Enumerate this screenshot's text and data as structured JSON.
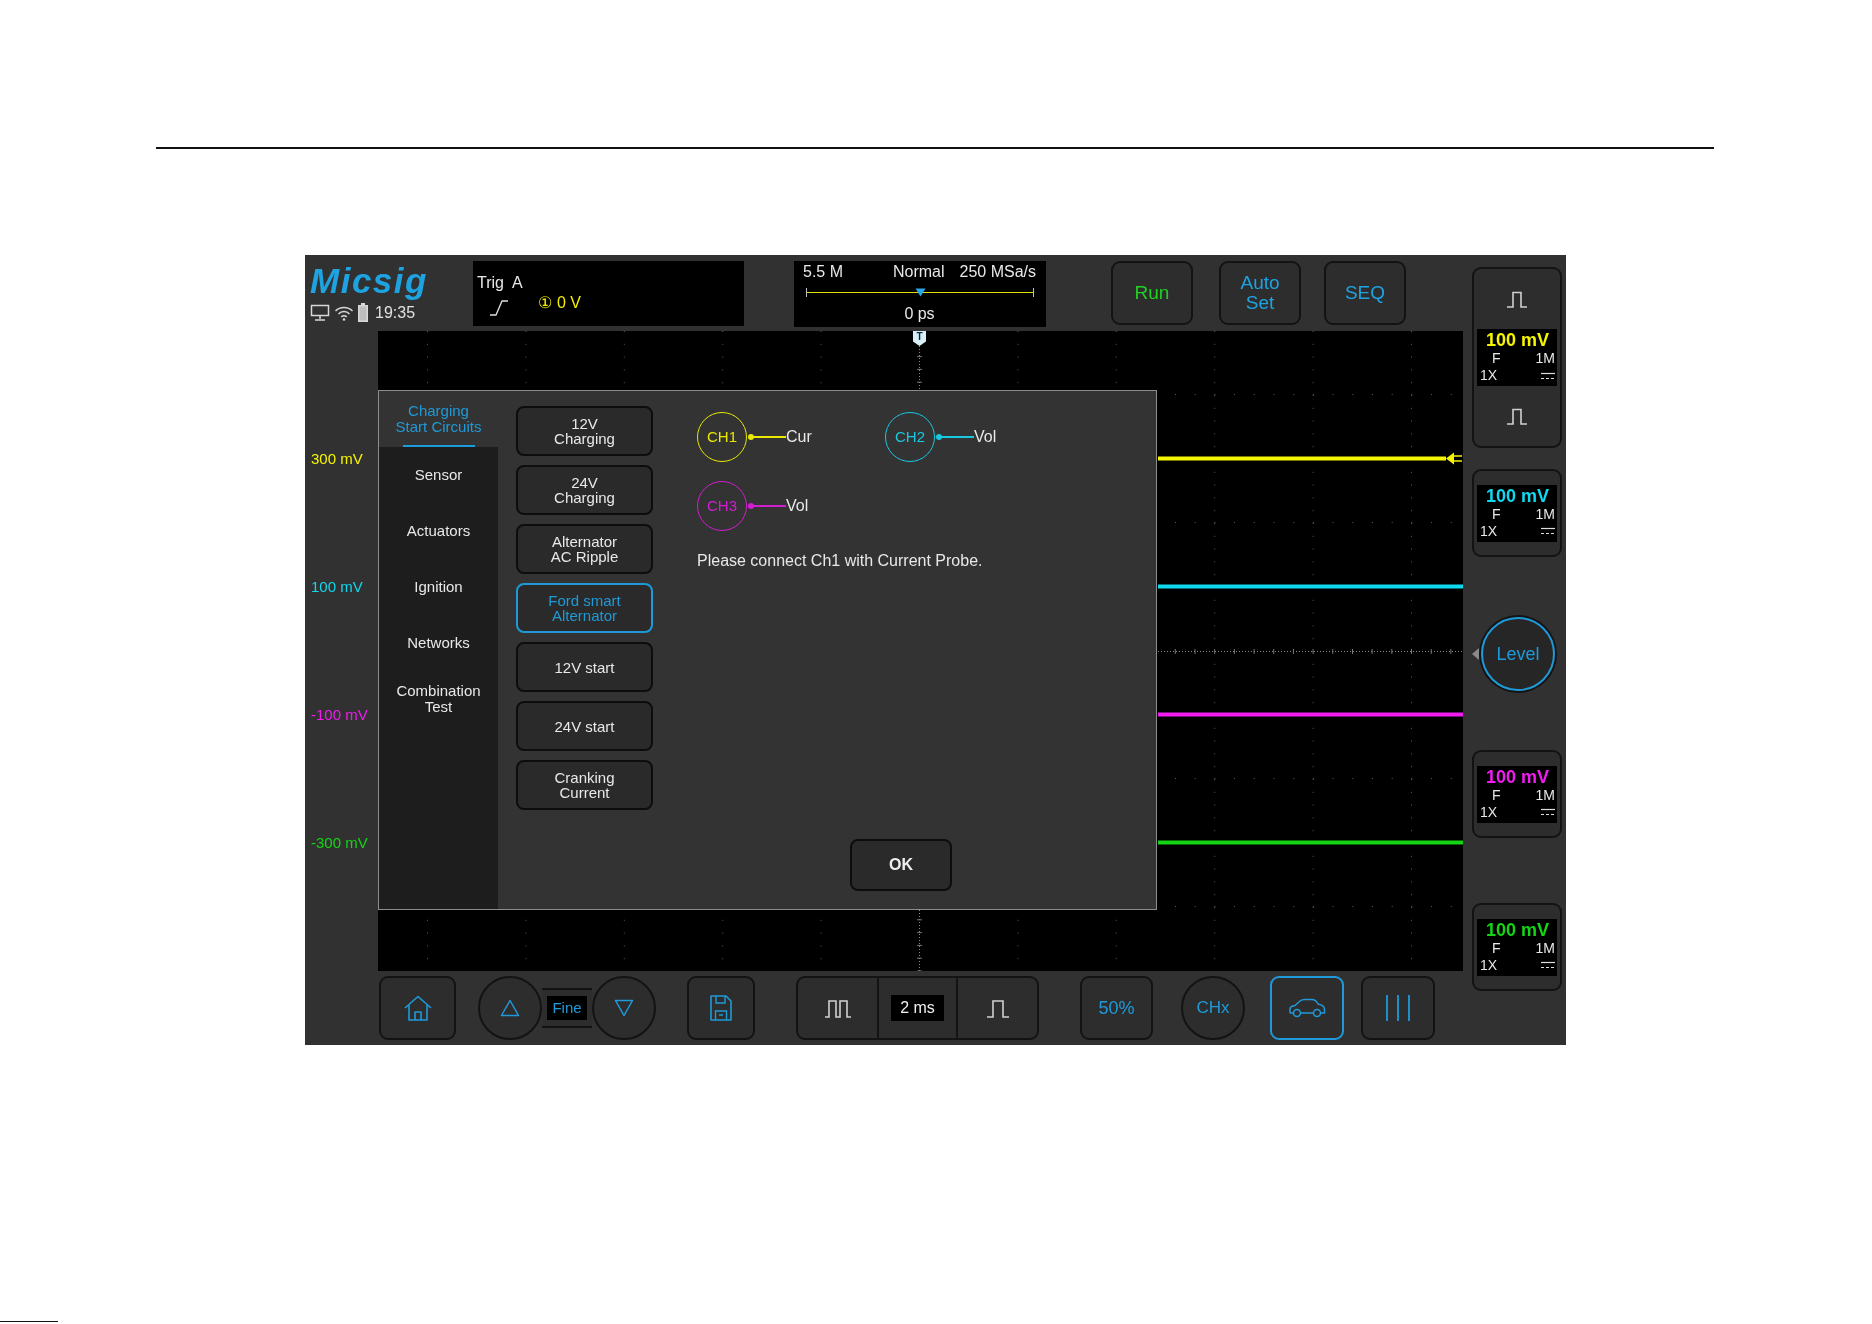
{
  "header": {
    "logo": "Micsig",
    "status": {
      "time": "19:35"
    },
    "trigger": {
      "label": "Trig",
      "source": "A",
      "channel": "①",
      "value": "0 V"
    },
    "acquisition": {
      "memory": "5.5 M",
      "mode": "Normal",
      "sample_rate": "250 MSa/s",
      "level": 0.5,
      "position": "0 ps"
    },
    "buttons": [
      {
        "kind": "run",
        "label": "Run"
      },
      {
        "kind": "autoset",
        "label": "Auto\nSet"
      },
      {
        "kind": "sequence",
        "label": "SEQ"
      }
    ]
  },
  "plot": {
    "trigger_marker": "T"
  },
  "channels": [
    {
      "offset": "300 mV",
      "color": "#f5f500",
      "selected": true,
      "scale": "100 mV",
      "bandwidth": "F",
      "impedance": "1M",
      "probe": "1X"
    },
    {
      "offset": "100 mV",
      "color": "#10d8ee",
      "selected": false,
      "scale": "100 mV",
      "bandwidth": "F",
      "impedance": "1M",
      "probe": "1X"
    },
    {
      "offset": "-100 mV",
      "color": "#f01cf0",
      "selected": false,
      "scale": "100 mV",
      "bandwidth": "F",
      "impedance": "1M",
      "probe": "1X"
    },
    {
      "offset": "-300 mV",
      "color": "#14d414",
      "selected": false,
      "scale": "100 mV",
      "bandwidth": "F",
      "impedance": "1M",
      "probe": "1X"
    }
  ],
  "level_knob": {
    "label": "Level"
  },
  "dialog": {
    "categories": [
      {
        "label": "Charging\nStart Circuits",
        "selected": true
      },
      {
        "label": "Sensor",
        "selected": false
      },
      {
        "label": "Actuators",
        "selected": false
      },
      {
        "label": "Ignition",
        "selected": false
      },
      {
        "label": "Networks",
        "selected": false
      },
      {
        "label": "Combination\nTest",
        "selected": false
      }
    ],
    "tests": [
      {
        "label": "12V\nCharging",
        "selected": false
      },
      {
        "label": "24V\nCharging",
        "selected": false
      },
      {
        "label": "Alternator\nAC Ripple",
        "selected": false
      },
      {
        "label": "Ford smart\nAlternator",
        "selected": true
      },
      {
        "label": "12V start",
        "selected": false
      },
      {
        "label": "24V start",
        "selected": false
      },
      {
        "label": "Cranking\nCurrent",
        "selected": false
      }
    ],
    "connections": [
      {
        "channel": "CH1",
        "signal": "Cur",
        "color": "#e8e800"
      },
      {
        "channel": "CH2",
        "signal": "Vol",
        "color": "#18c8e0"
      },
      {
        "channel": "CH3",
        "signal": "Vol",
        "color": "#d21ed2"
      }
    ],
    "message": "Please connect Ch1 with Current Probe.",
    "ok_label": "OK"
  },
  "toolbar": [
    {
      "kind": "home",
      "selected": false
    },
    {
      "kind": "fine",
      "label": "Fine",
      "selected": false
    },
    {
      "kind": "save",
      "selected": false
    },
    {
      "kind": "timebase",
      "label": "2 ms",
      "selected": false
    },
    {
      "kind": "text",
      "label": "50%",
      "selected": false
    },
    {
      "kind": "round",
      "label": "CHx",
      "selected": false
    },
    {
      "kind": "car",
      "selected": true
    },
    {
      "kind": "cursors",
      "selected": false
    }
  ]
}
